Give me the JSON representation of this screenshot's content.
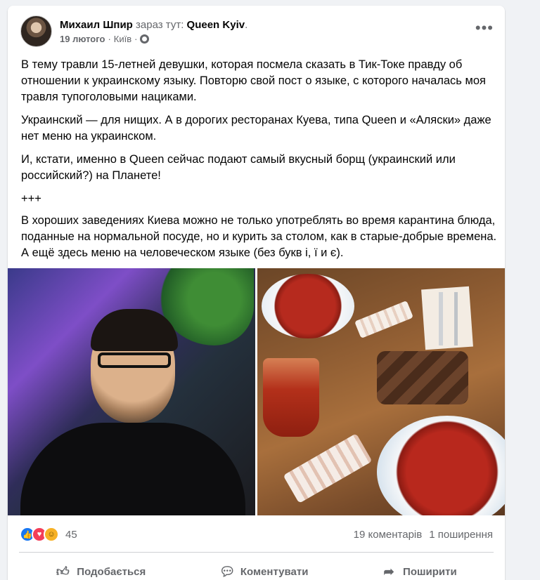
{
  "post": {
    "author": "Михаил Шпир",
    "at_text": " зараз тут: ",
    "place": "Queen Kyiv",
    "date": "19 лютого",
    "city": "Київ",
    "privacy_icon": "globe-icon",
    "more_label": "•••",
    "paragraphs": [
      "В тему травли 15-летней девушки, которая посмела сказать в Тик-Токе правду об отношении к украинскому языку. Повторю свой пост о языке, с которого началась моя травля тупоголовыми нациками.",
      "Украинский — для нищих. А в дорогих ресторанах Куева, типа Queen и «Аляски» даже нет меню на украинском.",
      "И, кстати, именно в Queen сейчас подают самый вкусный борщ (украинский или российский?) на Планете!",
      "+++",
      "В хороших заведениях Киева можно не только употреблять во время карантина блюда, поданные на нормальной посуде, но и курить за столом, как в старые-добрые времена. А ещё здесь меню на человеческом языке (без букв і, ї и є)."
    ]
  },
  "stats": {
    "reaction_icons": [
      "like-icon",
      "love-icon",
      "care-icon"
    ],
    "reaction_count": "45",
    "comments": "19 коментарів",
    "shares": "1 поширення"
  },
  "actions": {
    "like": "Подобається",
    "comment": "Коментувати",
    "share": "Поширити"
  },
  "colors": {
    "link_blue": "#1877f2",
    "love_red": "#f33e58",
    "care_yellow": "#f7b125",
    "secondary_text": "#65676b"
  }
}
